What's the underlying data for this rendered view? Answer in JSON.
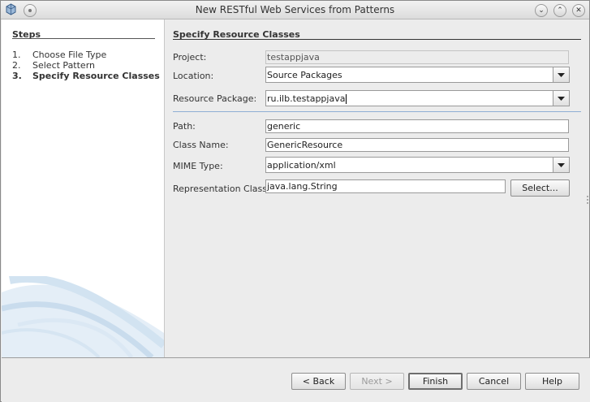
{
  "window": {
    "title": "New RESTful Web Services from Patterns"
  },
  "titlebar": {
    "min_icon": "chevron-down-icon",
    "max_icon": "chevron-up-icon",
    "close_icon": "close-icon"
  },
  "steps": {
    "heading": "Steps",
    "items": [
      {
        "num": "1.",
        "label": "Choose File Type",
        "active": false
      },
      {
        "num": "2.",
        "label": "Select Pattern",
        "active": false
      },
      {
        "num": "3.",
        "label": "Specify Resource Classes",
        "active": true
      }
    ]
  },
  "panel": {
    "heading": "Specify Resource Classes",
    "project": {
      "label": "Project:",
      "value": "testappjava"
    },
    "location": {
      "label": "Location:",
      "value": "Source Packages"
    },
    "resource_package": {
      "label": "Resource Package:",
      "value": "ru.ilb.testappjava"
    },
    "path": {
      "label": "Path:",
      "value": "generic"
    },
    "class_name": {
      "label": "Class Name:",
      "value": "GenericResource"
    },
    "mime_type": {
      "label": "MIME Type:",
      "value": "application/xml"
    },
    "representation_class": {
      "label": "Representation Class:",
      "value": "java.lang.String",
      "button": "Select..."
    }
  },
  "buttons": {
    "back": "< Back",
    "next": "Next >",
    "finish": "Finish",
    "cancel": "Cancel",
    "help": "Help"
  }
}
